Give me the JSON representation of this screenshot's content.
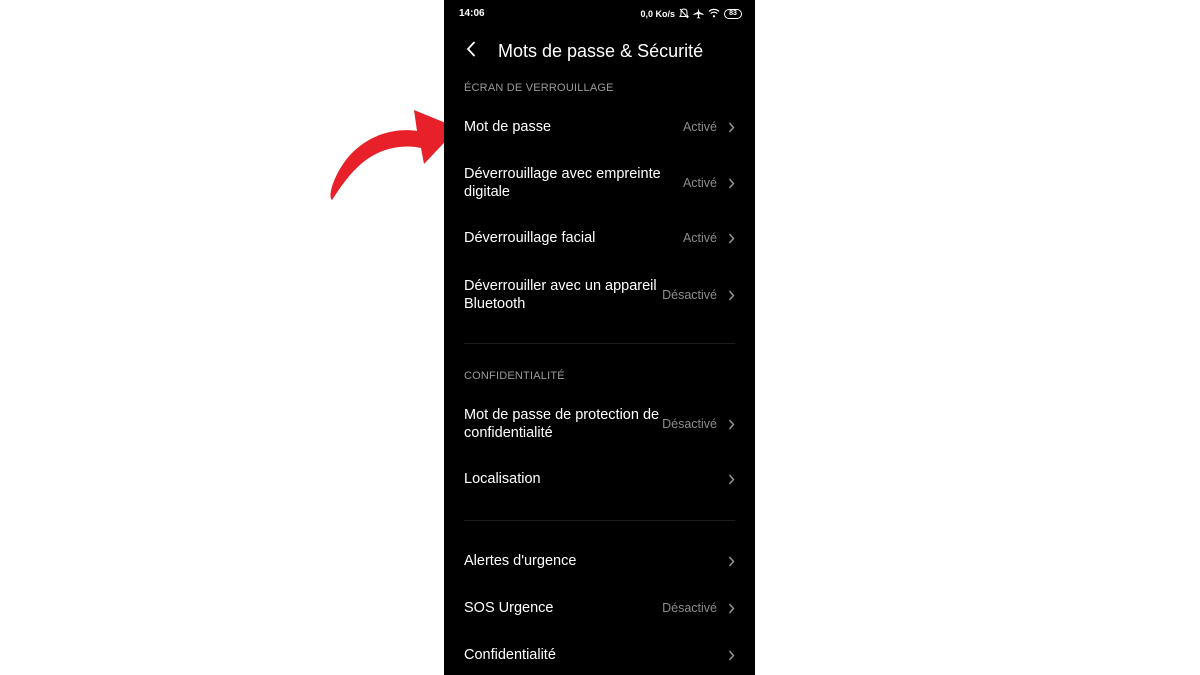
{
  "status_bar": {
    "time": "14:06",
    "net_speed": "0,0 Ko/s",
    "battery": "83",
    "icons": [
      "bell-off-icon",
      "airplane-icon",
      "wifi-icon",
      "battery-icon"
    ]
  },
  "header": {
    "back_icon": "back-arrow-icon",
    "title": "Mots de passe & Sécurité"
  },
  "sections": [
    {
      "header": "ÉCRAN DE VERROUILLAGE",
      "items": [
        {
          "label": "Mot de passe",
          "value": "Activé"
        },
        {
          "label": "Déverrouillage avec empreinte digitale",
          "value": "Activé"
        },
        {
          "label": "Déverrouillage facial",
          "value": "Activé"
        },
        {
          "label": "Déverrouiller avec un appareil Bluetooth",
          "value": "Désactivé"
        }
      ]
    },
    {
      "header": "CONFIDENTIALITÉ",
      "items": [
        {
          "label": "Mot de passe de protection de confidentialité",
          "value": "Désactivé"
        },
        {
          "label": "Localisation",
          "value": ""
        }
      ]
    },
    {
      "header": "",
      "items": [
        {
          "label": "Alertes d'urgence",
          "value": ""
        },
        {
          "label": "SOS Urgence",
          "value": "Désactivé"
        },
        {
          "label": "Confidentialité",
          "value": ""
        }
      ]
    }
  ],
  "annotation": {
    "icon": "curved-arrow-icon",
    "color": "#e8202a"
  },
  "colors": {
    "background": "#000000",
    "text": "#ffffff",
    "secondary": "#8c8c8c",
    "arrow": "#e8202a"
  }
}
